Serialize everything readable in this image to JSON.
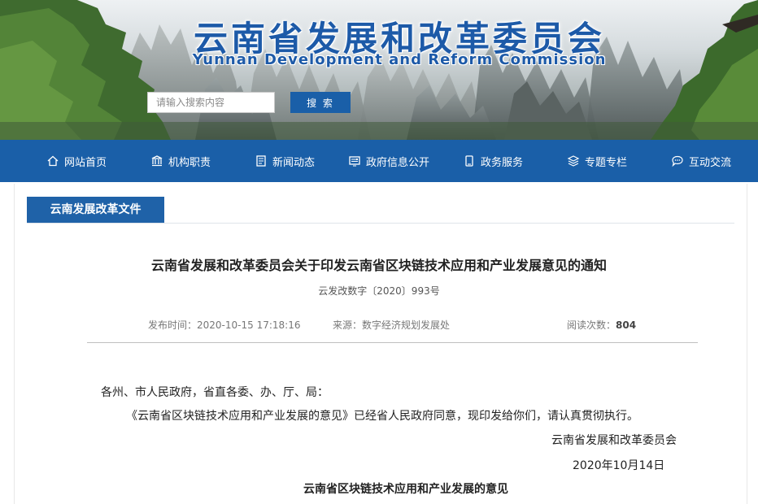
{
  "header": {
    "title": "云南省发展和改革委员会",
    "subtitle": "Yunnan Development and Reform Commission",
    "search": {
      "placeholder": "请输入搜索内容",
      "button_label": "搜 索"
    }
  },
  "nav": {
    "items": [
      {
        "label": "网站首页",
        "icon": "home-icon"
      },
      {
        "label": "机构职责",
        "icon": "institution-icon"
      },
      {
        "label": "新闻动态",
        "icon": "news-icon"
      },
      {
        "label": "政府信息公开",
        "icon": "info-disclosure-icon"
      },
      {
        "label": "政务服务",
        "icon": "service-icon"
      },
      {
        "label": "专题专栏",
        "icon": "layers-icon"
      },
      {
        "label": "互动交流",
        "icon": "chat-icon"
      }
    ]
  },
  "section": {
    "tab_label": "云南发展改革文件"
  },
  "article": {
    "title": "云南省发展和改革委员会关于印发云南省区块链技术应用和产业发展意见的通知",
    "doc_number": "云发改数字〔2020〕993号",
    "meta": {
      "date_label": "发布时间：",
      "date_value": "2020-10-15 17:18:16",
      "source_label": "来源：",
      "source_value": "数字经济规划发展处",
      "views_label": "阅读次数：",
      "views_value": "804"
    },
    "salutation": "各州、市人民政府，省直各委、办、厅、局：",
    "paragraph": "《云南省区块链技术应用和产业发展的意见》已经省人民政府同意，现印发给你们，请认真贯彻执行。",
    "signer": "云南省发展和改革委员会",
    "sign_date": "2020年10月14日",
    "sub_title": "云南省区块链技术应用和产业发展的意见"
  },
  "colors": {
    "brand_blue": "#1a5fa8",
    "title_blue": "#1d5aa8"
  }
}
